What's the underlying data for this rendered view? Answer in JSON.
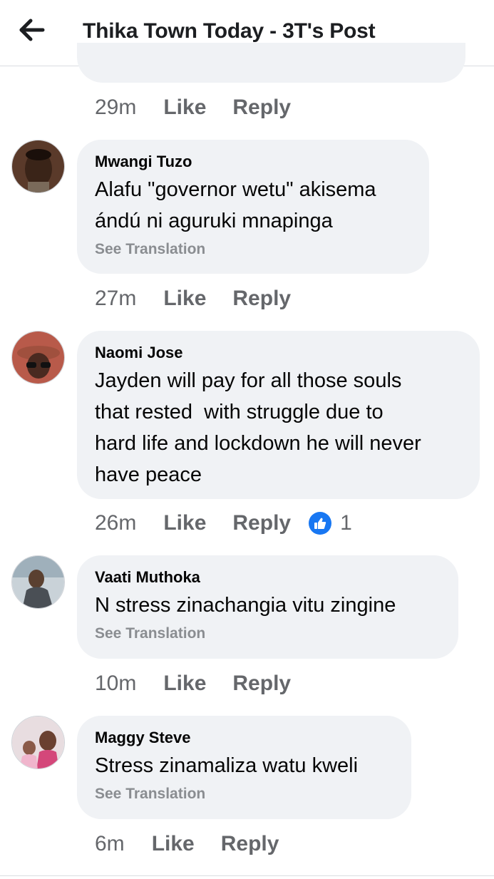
{
  "header": {
    "title": "Thika Town Today - 3T's Post"
  },
  "previous": {
    "time": "29m",
    "like_label": "Like",
    "reply_label": "Reply"
  },
  "comments": [
    {
      "author": "Mwangi Tuzo",
      "text_lines": [
        "Alafu \"governor wetu\" akisema",
        "ándú ni aguruki mnapinga"
      ],
      "see_translation": "See Translation",
      "time": "27m",
      "like_label": "Like",
      "reply_label": "Reply"
    },
    {
      "author": "Naomi Jose",
      "text_lines": [
        "Jayden will pay for all those souls",
        "that rested  with struggle due to",
        "hard life and lockdown he will never",
        "have peace"
      ],
      "time": "26m",
      "like_label": "Like",
      "reply_label": "Reply",
      "reaction_count": "1",
      "reaction_icon": "thumbs-up-icon",
      "reaction_color": "#1877f2"
    },
    {
      "author": "Vaati Muthoka",
      "text_lines": [
        "N stress zinachangia vitu zingine"
      ],
      "see_translation": "See Translation",
      "time": "10m",
      "like_label": "Like",
      "reply_label": "Reply"
    },
    {
      "author": "Maggy Steve",
      "text_lines": [
        "Stress zinamaliza watu kweli"
      ],
      "see_translation": "See Translation",
      "time": "6m",
      "like_label": "Like",
      "reply_label": "Reply"
    }
  ],
  "colors": {
    "bubble": "#f0f2f5",
    "secondary_text": "#65676b",
    "translation_text": "#8a8d91",
    "like_blue": "#1877f2"
  }
}
